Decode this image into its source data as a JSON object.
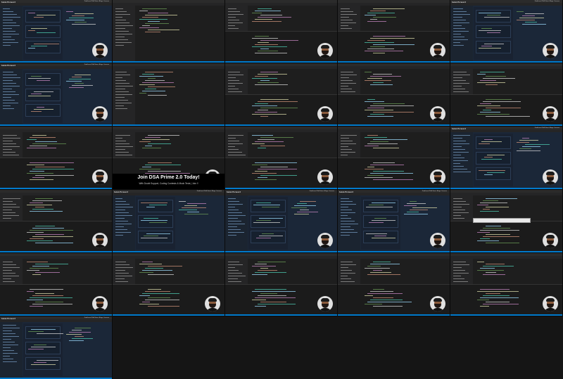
{
  "sheet": {
    "columns": 5,
    "rows": 5
  },
  "brand": {
    "name": "takeUforward"
  },
  "nav": {
    "items": [
      "Problems",
      "DSA Sheet",
      "Blogs",
      "Courses"
    ]
  },
  "banner": {
    "title": "Join DSA Prime 2.0 Today!",
    "subtitle": "With Doubt Support, Coding Contests & Mock Tests | Join !!"
  },
  "colors": {
    "editor_bg": "#1e1e1e",
    "site_bg": "#1b2738",
    "status_bar": "#007acc",
    "keyword": "#c586c0",
    "function": "#dcdcaa",
    "string": "#ce9178",
    "type": "#4ec9b0",
    "variable": "#9cdcfe",
    "comment": "#6a9955"
  },
  "tiles": [
    {
      "kind": "site",
      "avatar": true
    },
    {
      "kind": "code",
      "avatar": false
    },
    {
      "kind": "code-term",
      "avatar": true
    },
    {
      "kind": "code-term",
      "avatar": true
    },
    {
      "kind": "site",
      "avatar": true
    },
    {
      "kind": "site",
      "avatar": true
    },
    {
      "kind": "code",
      "avatar": false
    },
    {
      "kind": "code-term",
      "avatar": true
    },
    {
      "kind": "code-term",
      "avatar": true
    },
    {
      "kind": "code-term",
      "avatar": true
    },
    {
      "kind": "code-term",
      "avatar": true
    },
    {
      "kind": "code-banner",
      "avatar": true,
      "banner": true
    },
    {
      "kind": "code-term",
      "avatar": true
    },
    {
      "kind": "code-term",
      "avatar": true
    },
    {
      "kind": "site",
      "avatar": true
    },
    {
      "kind": "code-term",
      "avatar": true
    },
    {
      "kind": "site",
      "avatar": false
    },
    {
      "kind": "site",
      "avatar": true
    },
    {
      "kind": "site",
      "avatar": true
    },
    {
      "kind": "code-term",
      "avatar": true,
      "popup": true
    },
    {
      "kind": "code-term",
      "avatar": true
    },
    {
      "kind": "code-term",
      "avatar": true
    },
    {
      "kind": "code-term",
      "avatar": true
    },
    {
      "kind": "code-term",
      "avatar": true
    },
    {
      "kind": "code-term",
      "avatar": true
    },
    {
      "kind": "site",
      "avatar": false
    }
  ]
}
